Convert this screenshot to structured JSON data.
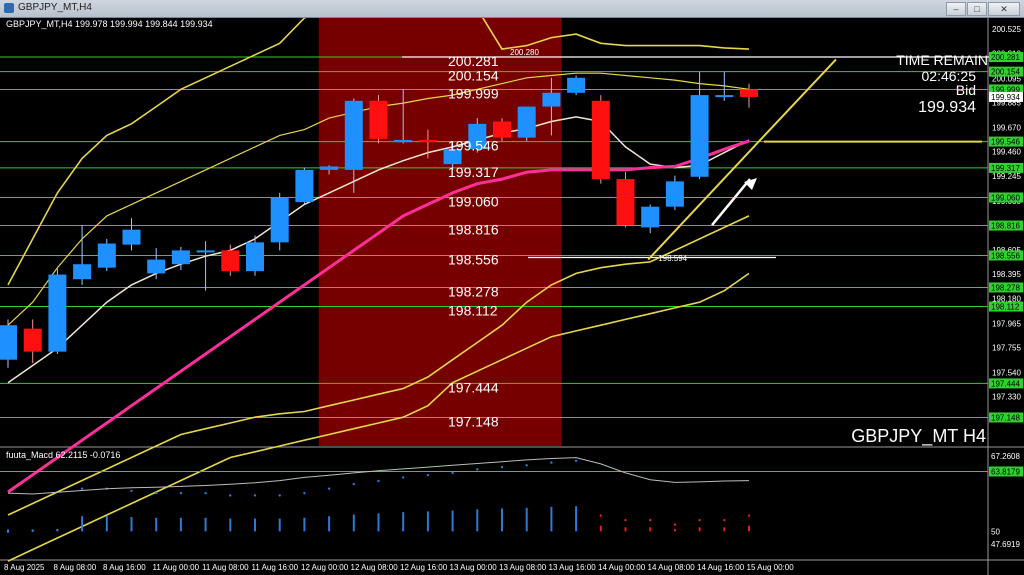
{
  "window": {
    "title": "GBPJPY_MT,H4",
    "min_label": "–",
    "max_label": "□",
    "close_label": "✕"
  },
  "info_line": "GBPJPY_MT,H4  199.978 199.994 199.844 199.934",
  "watermark": "GBPJPY_MT H4",
  "time_remain": {
    "label": "TIME REMAIN",
    "value": "02:46:25",
    "bid_label": "Bid",
    "bid_value": "199.934"
  },
  "macd_label": "fuuta_Macd 62.2115  -0.0716",
  "colors": {
    "bull": "#1e90ff",
    "bear": "#ff1010",
    "band": "#e6d64a",
    "ma_fast": "#f0e6d2",
    "ma_slow": "#ff2f9a",
    "level": "#2fd12f",
    "shade": "#8b0000",
    "macd_line": "#bbbbbb"
  },
  "chart_data": {
    "type": "candlestick",
    "symbol": "GBPJPY_MT",
    "timeframe": "H4",
    "ylim": [
      196.9,
      200.62
    ],
    "y_ticks": [
      200.525,
      200.31,
      200.095,
      199.885,
      199.67,
      199.46,
      199.245,
      199.03,
      198.82,
      198.605,
      198.395,
      198.18,
      197.965,
      197.755,
      197.54,
      197.33
    ],
    "level_labels": [
      {
        "text": "200.281",
        "value": 200.281
      },
      {
        "text": "200.154",
        "value": 200.154
      },
      {
        "text": "199.999",
        "value": 199.999
      },
      {
        "text": "199.546",
        "value": 199.546
      },
      {
        "text": "199.317",
        "value": 199.317
      },
      {
        "text": "199.060",
        "value": 199.06
      },
      {
        "text": "198.816",
        "value": 198.816
      },
      {
        "text": "198.556",
        "value": 198.556
      },
      {
        "text": "198.278",
        "value": 198.278
      },
      {
        "text": "198.112",
        "value": 198.112
      },
      {
        "text": "197.444",
        "value": 197.444
      },
      {
        "text": "197.148",
        "value": 197.148
      }
    ],
    "axis_boxes": [
      {
        "text": "200.281",
        "value": 200.281
      },
      {
        "text": "200.154",
        "value": 200.154
      },
      {
        "text": "199.999",
        "value": 199.999
      },
      {
        "text": "199.934",
        "value": 199.934
      },
      {
        "text": "199.546",
        "value": 199.546
      },
      {
        "text": "199.317",
        "value": 199.317
      },
      {
        "text": "199.060",
        "value": 199.06
      },
      {
        "text": "198.816",
        "value": 198.816
      },
      {
        "text": "198.556",
        "value": 198.556
      },
      {
        "text": "198.278",
        "value": 198.278
      },
      {
        "text": "198.112",
        "value": 198.112
      },
      {
        "text": "197.444",
        "value": 197.444
      },
      {
        "text": "197.148",
        "value": 197.148
      }
    ],
    "annotations": [
      {
        "text": "200.280",
        "value": 200.28,
        "index": 20
      },
      {
        "text": "198.594",
        "value": 198.594,
        "index": 26
      }
    ],
    "x_labels": [
      "8 Aug 2025",
      "8 Aug 08:00",
      "8 Aug 16:00",
      "11 Aug 00:00",
      "11 Aug 08:00",
      "11 Aug 16:00",
      "12 Aug 00:00",
      "12 Aug 08:00",
      "12 Aug 16:00",
      "13 Aug 00:00",
      "13 Aug 08:00",
      "13 Aug 16:00",
      "14 Aug 00:00",
      "14 Aug 08:00",
      "14 Aug 16:00",
      "15 Aug 00:00"
    ],
    "candles": [
      {
        "o": 197.65,
        "h": 198.0,
        "l": 197.58,
        "c": 197.95
      },
      {
        "o": 197.92,
        "h": 198.0,
        "l": 197.62,
        "c": 197.72
      },
      {
        "o": 197.72,
        "h": 198.44,
        "l": 197.7,
        "c": 198.39
      },
      {
        "o": 198.35,
        "h": 198.82,
        "l": 198.3,
        "c": 198.48
      },
      {
        "o": 198.45,
        "h": 198.7,
        "l": 198.42,
        "c": 198.66
      },
      {
        "o": 198.65,
        "h": 198.88,
        "l": 198.6,
        "c": 198.78
      },
      {
        "o": 198.4,
        "h": 198.62,
        "l": 198.35,
        "c": 198.52
      },
      {
        "o": 198.48,
        "h": 198.63,
        "l": 198.43,
        "c": 198.6
      },
      {
        "o": 198.6,
        "h": 198.68,
        "l": 198.25,
        "c": 198.6
      },
      {
        "o": 198.6,
        "h": 198.65,
        "l": 198.38,
        "c": 198.42
      },
      {
        "o": 198.42,
        "h": 198.73,
        "l": 198.38,
        "c": 198.67
      },
      {
        "o": 198.67,
        "h": 199.1,
        "l": 198.6,
        "c": 199.06
      },
      {
        "o": 199.02,
        "h": 199.32,
        "l": 199.0,
        "c": 199.3
      },
      {
        "o": 199.3,
        "h": 199.34,
        "l": 199.26,
        "c": 199.33
      },
      {
        "o": 199.3,
        "h": 199.92,
        "l": 199.1,
        "c": 199.9
      },
      {
        "o": 199.9,
        "h": 199.95,
        "l": 199.53,
        "c": 199.57
      },
      {
        "o": 199.54,
        "h": 200.0,
        "l": 199.53,
        "c": 199.56
      },
      {
        "o": 199.56,
        "h": 199.65,
        "l": 199.4,
        "c": 199.54
      },
      {
        "o": 199.35,
        "h": 199.55,
        "l": 199.3,
        "c": 199.48
      },
      {
        "o": 199.48,
        "h": 199.75,
        "l": 199.45,
        "c": 199.7
      },
      {
        "o": 199.72,
        "h": 199.75,
        "l": 199.55,
        "c": 199.58
      },
      {
        "o": 199.58,
        "h": 199.85,
        "l": 199.55,
        "c": 199.85
      },
      {
        "o": 199.85,
        "h": 200.1,
        "l": 199.6,
        "c": 199.97
      },
      {
        "o": 199.97,
        "h": 200.12,
        "l": 199.95,
        "c": 200.1
      },
      {
        "o": 199.9,
        "h": 199.95,
        "l": 199.18,
        "c": 199.22
      },
      {
        "o": 199.22,
        "h": 199.28,
        "l": 198.8,
        "c": 198.82
      },
      {
        "o": 198.8,
        "h": 199.0,
        "l": 198.75,
        "c": 198.98
      },
      {
        "o": 198.98,
        "h": 199.25,
        "l": 198.95,
        "c": 199.2
      },
      {
        "o": 199.24,
        "h": 200.15,
        "l": 199.22,
        "c": 199.95
      },
      {
        "o": 199.95,
        "h": 200.15,
        "l": 199.9,
        "c": 199.95
      },
      {
        "o": 200.0,
        "h": 200.05,
        "l": 199.84,
        "c": 199.934
      }
    ],
    "shaded_range": [
      13,
      22
    ],
    "upper_band": [
      198.3,
      198.7,
      199.1,
      199.4,
      199.6,
      199.7,
      199.85,
      200.0,
      200.1,
      200.2,
      200.3,
      200.4,
      200.62,
      200.7,
      200.75,
      200.75,
      200.75,
      200.75,
      200.75,
      200.7,
      200.35,
      200.38,
      200.45,
      200.48,
      200.4,
      200.38,
      200.38,
      200.38,
      200.38,
      200.36,
      200.35
    ],
    "mid_band": [
      197.95,
      198.15,
      198.45,
      198.7,
      198.9,
      199.0,
      199.1,
      199.2,
      199.3,
      199.4,
      199.5,
      199.6,
      199.65,
      199.75,
      199.8,
      199.85,
      199.88,
      199.92,
      199.95,
      200.0,
      200.05,
      200.1,
      200.12,
      200.14,
      200.14,
      200.12,
      200.1,
      200.08,
      200.05,
      200.03,
      200.0
    ],
    "lower_band": [
      196.3,
      196.4,
      196.5,
      196.6,
      196.7,
      196.8,
      196.9,
      197.0,
      197.05,
      197.1,
      197.15,
      197.18,
      197.2,
      197.25,
      197.3,
      197.35,
      197.4,
      197.5,
      197.65,
      197.8,
      197.95,
      198.15,
      198.3,
      198.4,
      198.45,
      198.48,
      198.5,
      198.6,
      198.7,
      198.8,
      198.9
    ],
    "lower_band2": [
      195.9,
      196.0,
      196.1,
      196.2,
      196.3,
      196.4,
      196.5,
      196.6,
      196.7,
      196.8,
      196.85,
      196.9,
      196.95,
      197.0,
      197.05,
      197.1,
      197.15,
      197.25,
      197.45,
      197.55,
      197.65,
      197.75,
      197.85,
      197.9,
      197.95,
      198.0,
      198.05,
      198.1,
      198.15,
      198.25,
      198.4
    ],
    "ma_fast": [
      197.45,
      197.6,
      197.75,
      197.95,
      198.15,
      198.3,
      198.4,
      198.48,
      198.55,
      198.6,
      198.7,
      198.85,
      199.0,
      199.1,
      199.2,
      199.3,
      199.38,
      199.45,
      199.5,
      199.56,
      199.62,
      199.66,
      199.72,
      199.76,
      199.72,
      199.5,
      199.35,
      199.32,
      199.34,
      199.45,
      199.56
    ],
    "ma_slow": [
      196.5,
      196.65,
      196.8,
      196.95,
      197.1,
      197.25,
      197.4,
      197.55,
      197.7,
      197.85,
      198.0,
      198.15,
      198.3,
      198.45,
      198.6,
      198.75,
      198.9,
      199.0,
      199.1,
      199.18,
      199.22,
      199.28,
      199.3,
      199.3,
      199.3,
      199.3,
      199.32,
      199.33,
      199.4,
      199.48,
      199.55
    ]
  },
  "macd_data": {
    "range": [
      47.6919,
      67.2608
    ],
    "ticks": [
      {
        "text": "67.2608",
        "value": 67.2608
      },
      {
        "text": "63.8179",
        "value": 63.8179
      },
      {
        "text": "50",
        "value": 50.5
      },
      {
        "text": "47.6919",
        "value": 47.6919
      }
    ],
    "line": [
      59,
      58.8,
      59.2,
      59.6,
      60,
      60.2,
      60.3,
      60.5,
      60.7,
      61,
      61.3,
      61.8,
      62.5,
      63,
      63.5,
      64,
      64.4,
      64.8,
      65.2,
      65.6,
      66,
      66.4,
      66.7,
      66.9,
      65.5,
      63.5,
      62,
      61.4,
      61.5,
      61.7,
      61.8
    ],
    "hist": [
      50.4,
      50.6,
      50.8,
      60,
      60,
      59.5,
      59,
      59,
      59,
      58.5,
      58.5,
      58.5,
      59,
      60,
      61,
      61.7,
      62.5,
      63,
      63.5,
      64.3,
      64.8,
      65.2,
      65.8,
      66.2,
      54,
      53,
      53,
      52,
      53,
      53,
      54
    ],
    "hist_color": [
      "b",
      "b",
      "b",
      "b",
      "b",
      "b",
      "b",
      "b",
      "b",
      "b",
      "b",
      "b",
      "b",
      "b",
      "b",
      "b",
      "b",
      "b",
      "b",
      "b",
      "b",
      "b",
      "b",
      "b",
      "r",
      "r",
      "r",
      "r",
      "r",
      "r",
      "r"
    ]
  }
}
